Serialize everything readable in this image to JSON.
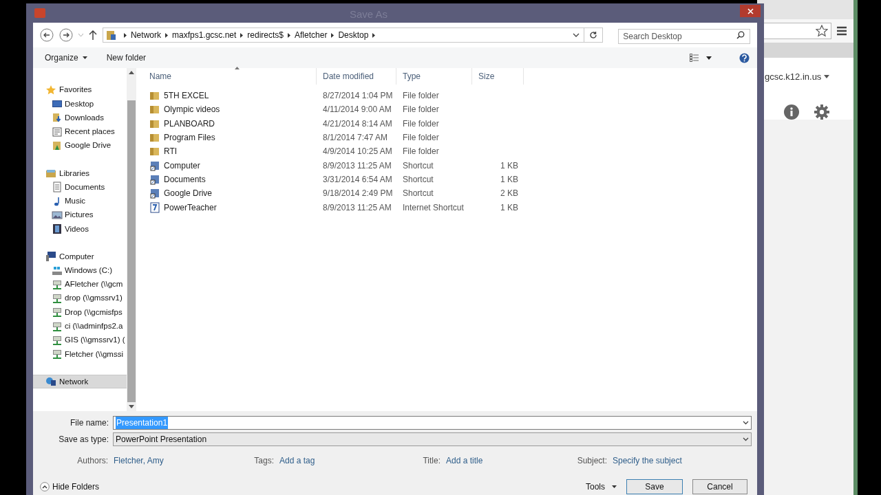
{
  "window": {
    "title": "Save As"
  },
  "address": {
    "path": [
      "Network",
      "maxfps1.gcsc.net",
      "redirects$",
      "Afletcher",
      "Desktop"
    ]
  },
  "search": {
    "placeholder": "Search Desktop"
  },
  "toolbar": {
    "organize": "Organize",
    "new_folder": "New folder"
  },
  "sidebar": {
    "groups": [
      {
        "label": "Favorites",
        "selected": false,
        "children": [
          {
            "label": "Desktop",
            "selected": false
          },
          {
            "label": "Downloads",
            "selected": false
          },
          {
            "label": "Recent places",
            "selected": false
          },
          {
            "label": "Google Drive",
            "selected": false
          }
        ]
      },
      {
        "label": "Libraries",
        "selected": false,
        "children": [
          {
            "label": "Documents",
            "selected": false
          },
          {
            "label": "Music",
            "selected": false
          },
          {
            "label": "Pictures",
            "selected": false
          },
          {
            "label": "Videos",
            "selected": false
          }
        ]
      },
      {
        "label": "Computer",
        "selected": false,
        "children": [
          {
            "label": "Windows (C:)",
            "selected": false
          },
          {
            "label": "AFletcher (\\\\gcm",
            "selected": false
          },
          {
            "label": "drop (\\\\gmssrv1)",
            "selected": false
          },
          {
            "label": "Drop (\\\\gcmisfps",
            "selected": false
          },
          {
            "label": "ci (\\\\adminfps2.a",
            "selected": false
          },
          {
            "label": "GIS (\\\\gmssrv1) (",
            "selected": false
          },
          {
            "label": "Fletcher (\\\\gmssi",
            "selected": false
          }
        ]
      },
      {
        "label": "Network",
        "selected": true
      }
    ]
  },
  "table": {
    "columns": [
      "Name",
      "Date modified",
      "Type",
      "Size"
    ],
    "rows": [
      {
        "kind": "folder",
        "name": "5TH EXCEL",
        "date": "8/27/2014 1:04 PM",
        "type": "File folder"
      },
      {
        "kind": "folder",
        "name": "Olympic videos",
        "date": "4/11/2014 9:00 AM",
        "type": "File folder"
      },
      {
        "kind": "folder",
        "name": "PLANBOARD",
        "date": "4/21/2014 8:14 AM",
        "type": "File folder"
      },
      {
        "kind": "folder",
        "name": "Program Files",
        "date": "8/1/2014 7:47 AM",
        "type": "File folder"
      },
      {
        "kind": "folder",
        "name": "RTI",
        "date": "4/9/2014 10:25 AM",
        "type": "File folder"
      },
      {
        "kind": "shortcut",
        "name": "Computer",
        "date": "8/9/2013 11:25 AM",
        "type": "Shortcut",
        "size": "1 KB"
      },
      {
        "kind": "shortcut",
        "name": "Documents",
        "date": "3/31/2014 6:54 AM",
        "type": "Shortcut",
        "size": "1 KB"
      },
      {
        "kind": "shortcut",
        "name": "Google Drive",
        "date": "9/18/2014 2:49 PM",
        "type": "Shortcut",
        "size": "2 KB"
      },
      {
        "kind": "internet",
        "name": "PowerTeacher",
        "date": "8/9/2013 11:25 AM",
        "type": "Internet Shortcut",
        "size": "1 KB"
      }
    ]
  },
  "file_name": {
    "label": "File name:",
    "value": "Presentation1"
  },
  "save_type": {
    "label": "Save as type:",
    "value": "PowerPoint Presentation"
  },
  "metadata": [
    {
      "label": "Authors:",
      "value": "Fletcher, Amy"
    },
    {
      "label": "Tags:",
      "value": "Add a tag"
    },
    {
      "label": "Title:",
      "value": "Add a title"
    },
    {
      "label": "Subject:",
      "value": "Specify the subject"
    }
  ],
  "footer": {
    "hide_folders": "Hide Folders",
    "tools": "Tools",
    "save": "Save",
    "cancel": "Cancel"
  },
  "background_window": {
    "account": "gcsc.k12.in.us"
  }
}
